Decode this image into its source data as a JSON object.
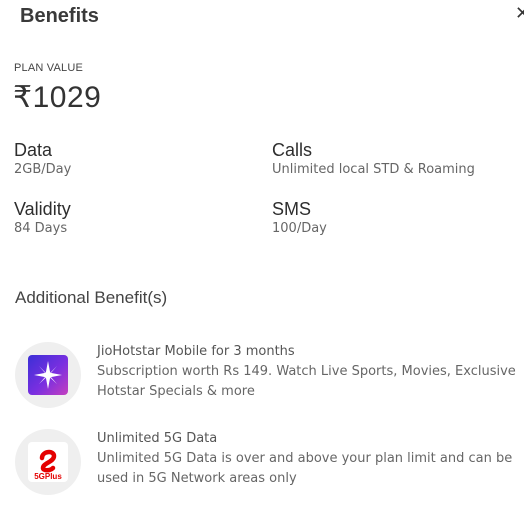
{
  "header": {
    "title": "Benefits",
    "close_icon": "close-icon"
  },
  "plan": {
    "label": "PLAN VALUE",
    "price": "₹1029"
  },
  "specs": [
    {
      "key": "Data",
      "value": "2GB/Day"
    },
    {
      "key": "Calls",
      "value": "Unlimited local STD & Roaming"
    },
    {
      "key": "Validity",
      "value": "84 Days"
    },
    {
      "key": "SMS",
      "value": "100/Day"
    }
  ],
  "additional": {
    "title": "Additional Benefit(s)",
    "items": [
      {
        "icon": "jiohotstar-icon",
        "title": "JioHotstar Mobile for 3 months",
        "description": "Subscription worth Rs 149. Watch Live Sports, Movies, Exclusive Hotstar Specials & more"
      },
      {
        "icon": "airtel-5g-plus-icon",
        "icon_text": "5GPlus",
        "title": "Unlimited 5G Data",
        "description": "Unlimited 5G Data is over and above your plan limit and can be used in 5G Network areas only"
      }
    ]
  },
  "colors": {
    "airtel_red": "#e40000",
    "hotstar_start": "#3b2fd6",
    "hotstar_end": "#c43fbf"
  }
}
